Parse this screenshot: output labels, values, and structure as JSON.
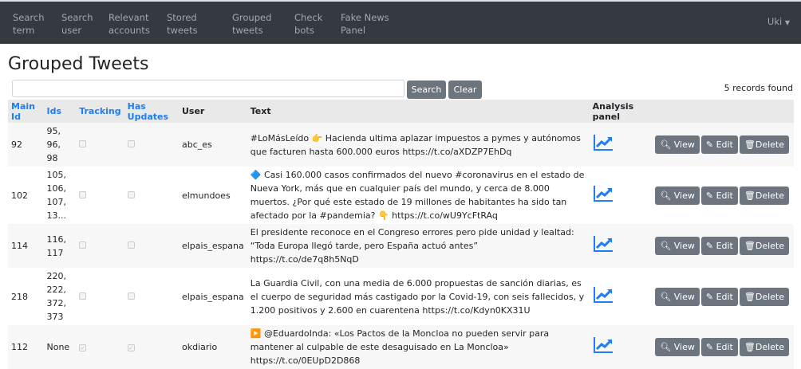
{
  "nav": {
    "items": [
      [
        "Search",
        "term"
      ],
      [
        "Search",
        "user"
      ],
      [
        "Relevant",
        "accounts"
      ],
      [
        "Stored",
        "tweets"
      ],
      [
        "Grouped",
        "tweets"
      ],
      [
        "Check",
        "bots"
      ],
      [
        "Fake News",
        "Panel"
      ]
    ],
    "user": "Uki"
  },
  "page": {
    "title": "Grouped Tweets",
    "search_placeholder": "",
    "search_label": "Search",
    "clear_label": "Clear",
    "records": "5 records found"
  },
  "table": {
    "headers": [
      "Main Id",
      "Ids",
      "Tracking",
      "Has Updates",
      "User",
      "Text",
      "Analysis panel"
    ],
    "actions": {
      "view": "View",
      "edit": "Edit",
      "delete": "Delete"
    },
    "rows": [
      {
        "main_id": "92",
        "ids": "95, 96, 98",
        "tracking": false,
        "has_updates": false,
        "user": "abc_es",
        "text": "#LoMásLeído 👉 Hacienda ultima aplazar impuestos a pymes y autónomos que facturen hasta 600.000 euros https://t.co/aXDZP7EhDq"
      },
      {
        "main_id": "102",
        "ids": "105, 106, 107, 13...",
        "tracking": false,
        "has_updates": false,
        "user": "elmundoes",
        "text": "🔷 Casi 160.000 casos confirmados del nuevo #coronavirus en el estado de Nueva York, más que en cualquier país del mundo, y cerca de 8.000 muertos. ¿Por qué este estado de 19 millones de habitantes ha sido tan afectado por la #pandemia? 👇 https://t.co/wU9YcFtRAq"
      },
      {
        "main_id": "114",
        "ids": "116, 117",
        "tracking": false,
        "has_updates": false,
        "user": "elpais_espana",
        "text": "El presidente reconoce en el Congreso errores pero pide unidad y lealtad: “Toda Europa llegó tarde, pero España actuó antes” https://t.co/de7q8h5NqD"
      },
      {
        "main_id": "218",
        "ids": "220, 222, 372, 373",
        "tracking": false,
        "has_updates": false,
        "user": "elpais_espana",
        "text": "La Guardia Civil, con una media de 6.000 propuestas de sanción diarias, es el cuerpo de seguridad más castigado por la Covid-19, con seis fallecidos, y 1.200 positivos y 2.600 en cuarentena https://t.co/Kdyn0KX31U"
      },
      {
        "main_id": "112",
        "ids": "None",
        "tracking": true,
        "has_updates": true,
        "user": "okdiario",
        "text": "▶️ @EduardoInda: «Los Pactos de la Moncloa no pueden servir para mantener al culpable de este desaguisado en La Moncloa» https://t.co/0EUpD2D868"
      }
    ]
  },
  "colors": {
    "navbar": "#343a40",
    "link": "#1e7ef2",
    "button": "#6c757d"
  }
}
